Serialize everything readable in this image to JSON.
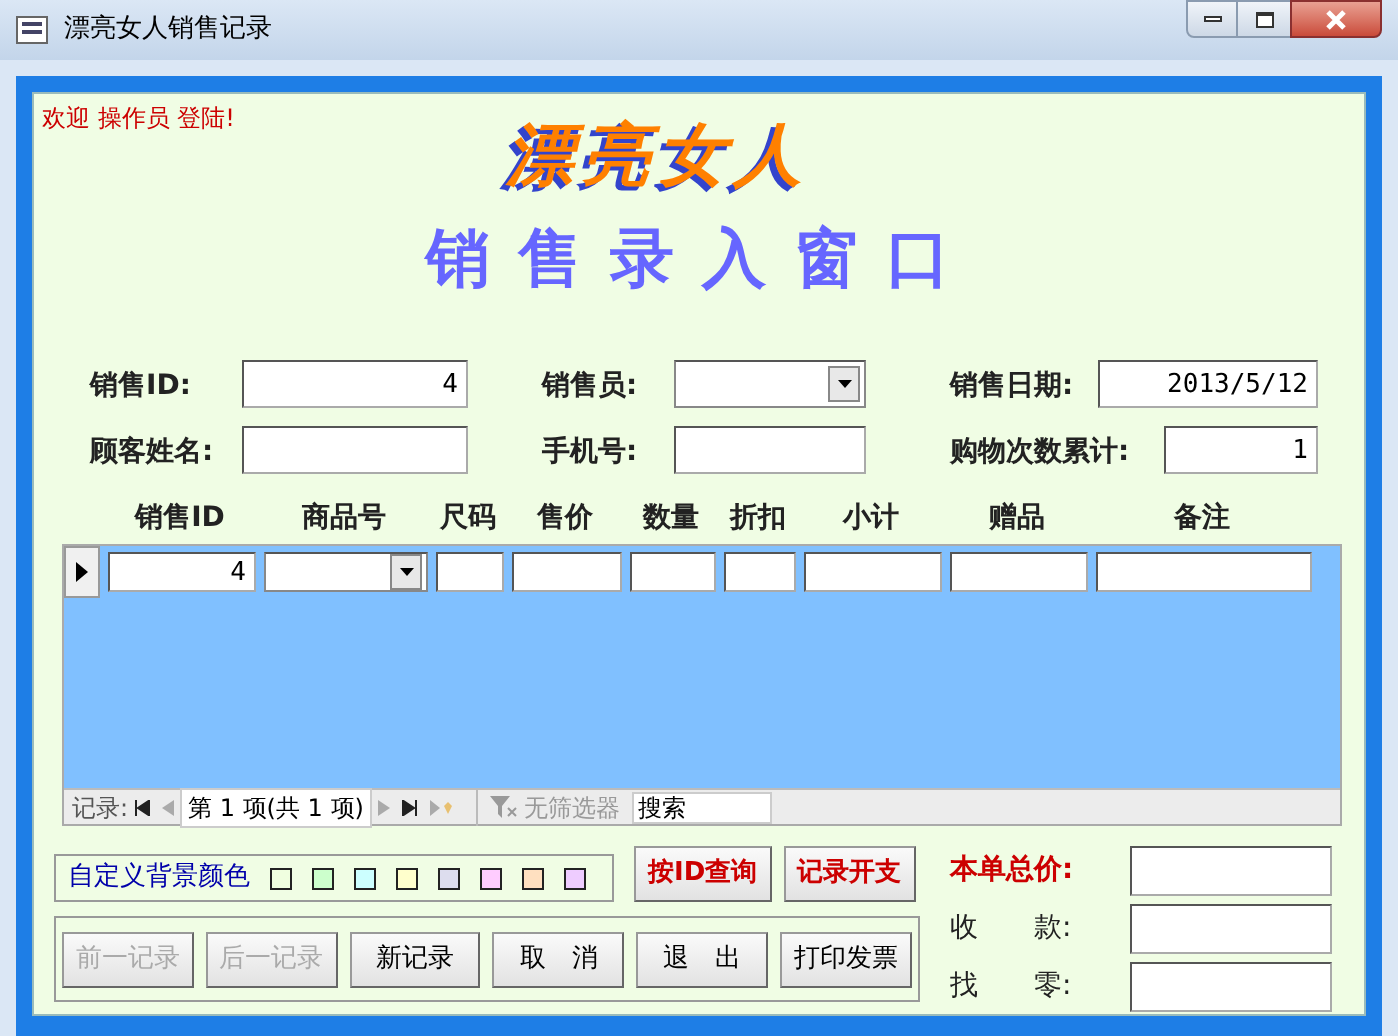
{
  "window": {
    "title": "漂亮女人销售记录"
  },
  "welcome": "欢迎 操作员 登陆!",
  "logo": "漂亮女人",
  "heading": "销售录入窗口",
  "fields": [
    {
      "label": "销售ID:",
      "kind": "text",
      "value": "4"
    },
    {
      "label": "销售员:",
      "kind": "combo"
    },
    {
      "label": "销售日期:",
      "kind": "text",
      "value": "2013/5/12"
    },
    {
      "label": "顾客姓名:",
      "kind": "text"
    },
    {
      "label": "手机号:",
      "kind": "text"
    },
    {
      "label": "购物次数累计:",
      "kind": "text",
      "value": "1"
    }
  ],
  "grid": {
    "columns": [
      {
        "label": "销售ID",
        "kind": "text"
      },
      {
        "label": "商品号",
        "kind": "combo"
      },
      {
        "label": "尺码",
        "kind": "text"
      },
      {
        "label": "售价",
        "kind": "text"
      },
      {
        "label": "数量",
        "kind": "text"
      },
      {
        "label": "折扣",
        "kind": "text"
      },
      {
        "label": "小计",
        "kind": "text"
      },
      {
        "label": "赠品",
        "kind": "text"
      },
      {
        "label": "备注",
        "kind": "text"
      }
    ],
    "rows": [
      {
        "selected": true,
        "cells": [
          "4",
          null,
          null,
          null,
          null,
          null,
          null,
          null,
          null
        ]
      }
    ],
    "navigator": {
      "label": "记录:",
      "position": "第 1 项(共 1 项)",
      "filter": "无筛选器",
      "search_placeholder": "搜索"
    }
  },
  "colors": {
    "label": "自定义背景颜色",
    "swatches": [
      {
        "color": "#f0ffe0"
      },
      {
        "color": "#ccffcc"
      },
      {
        "color": "#ccffff"
      },
      {
        "color": "#ffffcc"
      },
      {
        "color": "#ddddee"
      },
      {
        "color": "#ffccff"
      },
      {
        "color": "#ffe0c0"
      },
      {
        "color": "#eeccff"
      }
    ]
  },
  "action_buttons": [
    "按ID查询",
    "记录开支"
  ],
  "nav_buttons": [
    {
      "label": "前一记录",
      "disabled": true
    },
    {
      "label": "后一记录",
      "disabled": true
    },
    {
      "label": "新记录",
      "disabled": false
    },
    {
      "label": "取　消",
      "disabled": false
    },
    {
      "label": "退　出",
      "disabled": false
    },
    {
      "label": "打印发票",
      "disabled": false
    }
  ],
  "totals": [
    {
      "label": "本单总价:",
      "kind": "emphasis"
    },
    {
      "label": "收　　款:",
      "kind": "plain"
    },
    {
      "label": "找　　零:",
      "kind": "plain"
    }
  ]
}
